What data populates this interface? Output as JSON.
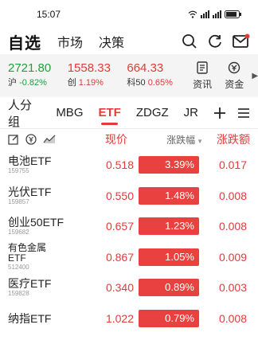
{
  "status_bar": {
    "time": "15:07",
    "battery": "77",
    "net": "HD"
  },
  "nav": {
    "title": "自选",
    "tabs": [
      "市场",
      "决策"
    ]
  },
  "indices": [
    {
      "value": "2721.80",
      "name": "沪",
      "change": "-0.82%",
      "color": "#1e9e3e"
    },
    {
      "value": "1558.33",
      "name": "创",
      "change": "1.19%",
      "color": "#e33a3a"
    },
    {
      "value": "664.33",
      "name": "科50",
      "change": "0.65%",
      "color": "#e33a3a"
    }
  ],
  "index_buttons": [
    {
      "label": "资讯",
      "icon": "news-icon"
    },
    {
      "label": "资金",
      "icon": "fund-flow-icon"
    }
  ],
  "tabs": {
    "items": [
      "人分组",
      "MBG",
      "ETF",
      "ZDGZ",
      "JR"
    ],
    "active": "ETF"
  },
  "columns": {
    "price": "现价",
    "pct": "涨跌幅",
    "chg": "涨跌额"
  },
  "rows": [
    {
      "name": "电池ETF",
      "code": "159755",
      "price": "0.518",
      "pct": "3.39%",
      "chg": "0.017"
    },
    {
      "name": "光伏ETF",
      "code": "159857",
      "price": "0.550",
      "pct": "1.48%",
      "chg": "0.008"
    },
    {
      "name": "创业50ETF",
      "code": "159682",
      "price": "0.657",
      "pct": "1.23%",
      "chg": "0.008"
    },
    {
      "name": "有色金属ETF",
      "code": "512400",
      "price": "0.867",
      "pct": "1.05%",
      "chg": "0.009"
    },
    {
      "name": "医疗ETF",
      "code": "159828",
      "price": "0.340",
      "pct": "0.89%",
      "chg": "0.003"
    },
    {
      "name": "纳指ETF",
      "code": "",
      "price": "1.022",
      "pct": "0.79%",
      "chg": "0.008"
    }
  ]
}
